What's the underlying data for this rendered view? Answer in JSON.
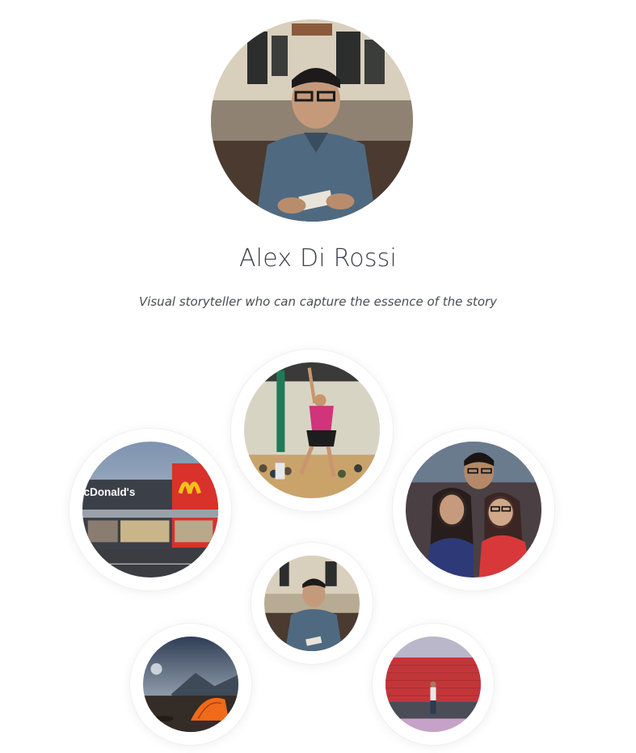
{
  "profile": {
    "name": "Alex Di Rossi",
    "tagline": "Visual storyteller who can capture the essence of the story"
  },
  "gallery": {
    "photos": [
      {
        "subject": "basketball-player",
        "storefront_text": ""
      },
      {
        "subject": "restaurant-storefront",
        "storefront_text": "cDonald's"
      },
      {
        "subject": "group-selfie",
        "storefront_text": ""
      },
      {
        "subject": "portrait-cafe",
        "storefront_text": ""
      },
      {
        "subject": "camping-tent",
        "storefront_text": ""
      },
      {
        "subject": "brick-wall-person",
        "storefront_text": ""
      }
    ]
  },
  "colors": {
    "text_dark": "#3e4148",
    "ring_bg": "#ffffff",
    "mcd_red": "#d8322a",
    "mcd_yellow": "#f4c11a"
  }
}
